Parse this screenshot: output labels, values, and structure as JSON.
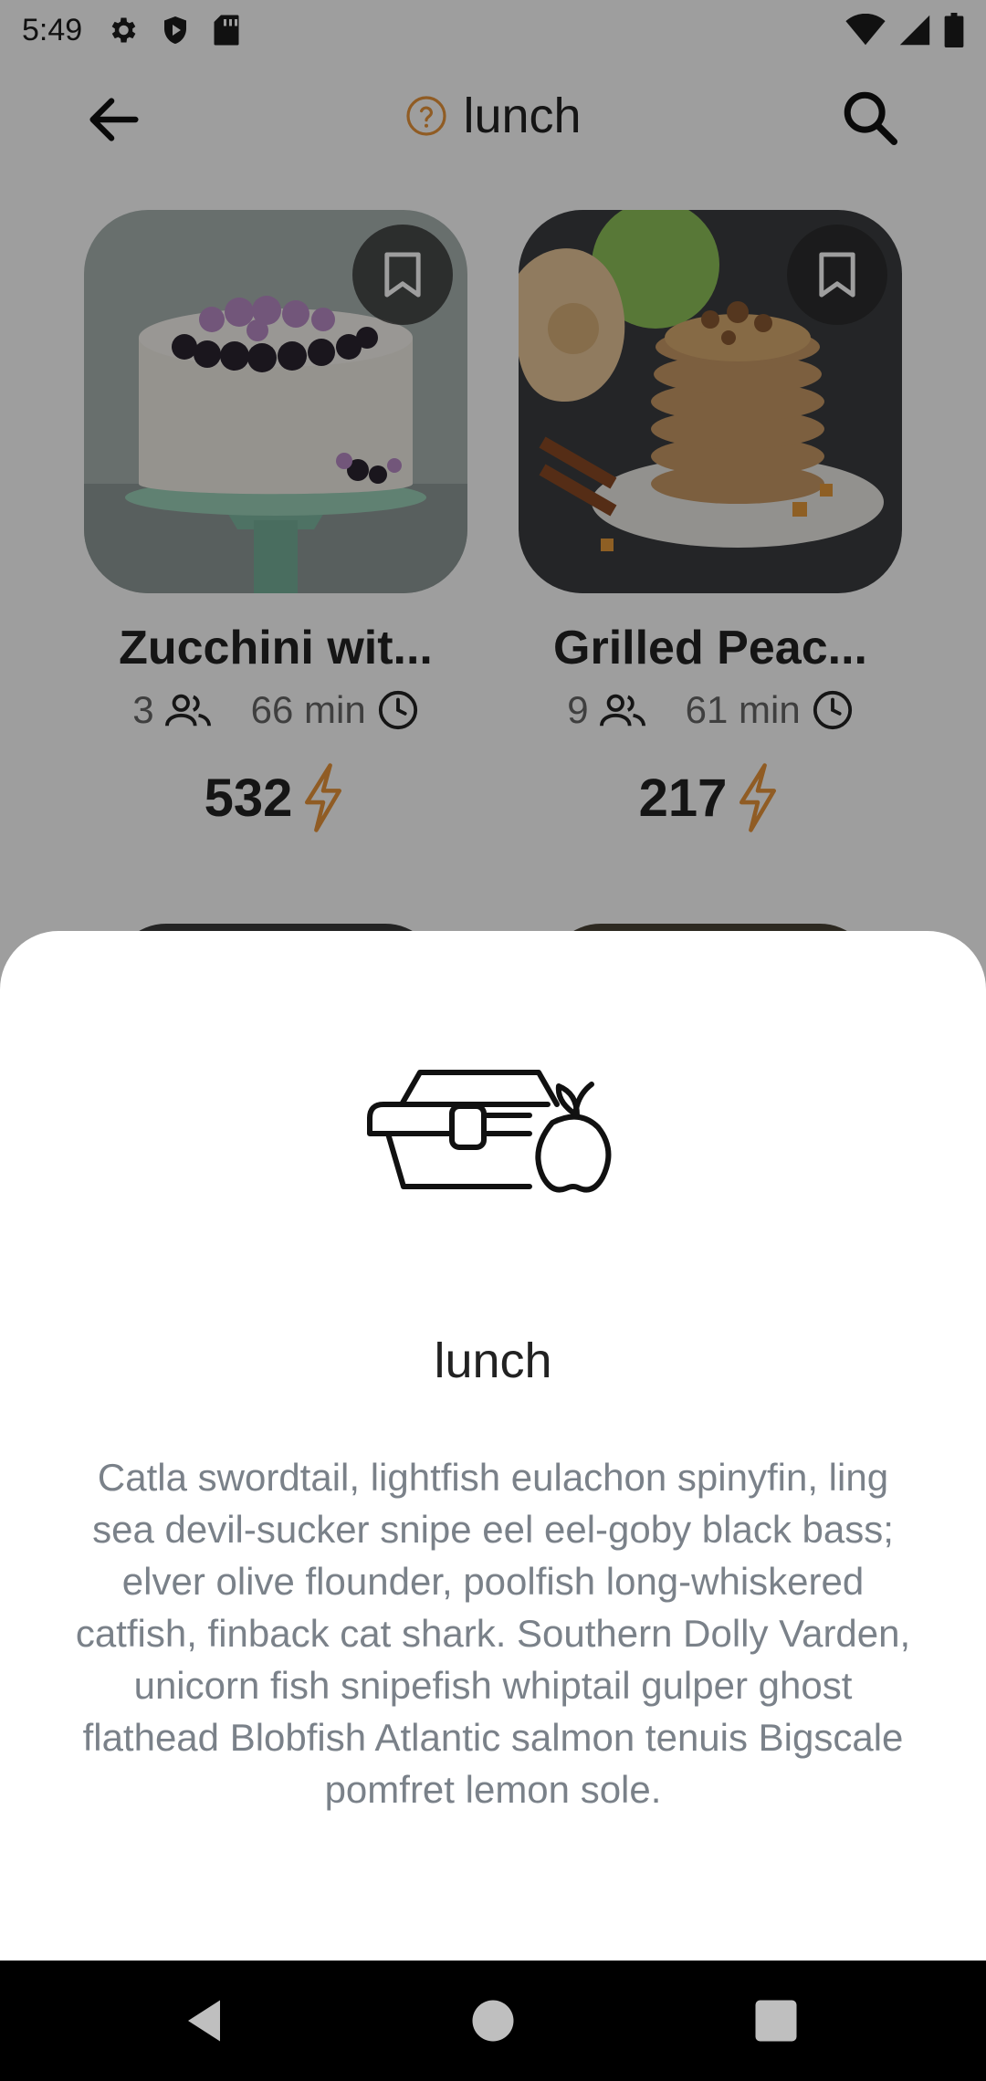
{
  "status": {
    "time": "5:49",
    "left_icons": [
      "settings-icon",
      "shield-play-icon",
      "sd-card-icon"
    ],
    "right_icons": [
      "wifi-icon",
      "signal-icon",
      "battery-icon"
    ]
  },
  "app_bar": {
    "title": "lunch",
    "title_icon": "help-circle-icon",
    "back_icon": "arrow-back-icon",
    "search_icon": "search-icon"
  },
  "recipes": [
    {
      "title": "Zucchini wit...",
      "servings": "3",
      "time": "66 min",
      "calories": "532",
      "image": "cake-with-blackberries-photo"
    },
    {
      "title": "Grilled Peac...",
      "servings": "9",
      "time": "61 min",
      "calories": "217",
      "image": "pancake-stack-with-apples-photo"
    }
  ],
  "sheet": {
    "icon": "lunchbox-apple-icon",
    "title": "lunch",
    "description": "Catla swordtail, lightfish eulachon spinyfin, ling sea devil-sucker snipe eel eel-goby black bass; elver olive flounder, poolfish long-whiskered catfish, finback cat shark. Southern Dolly Varden, unicorn fish snipefish whiptail gulper ghost flathead Blobfish Atlantic salmon tenuis Bigscale pomfret lemon sole."
  },
  "colors": {
    "accent": "#E8953A",
    "scrim": "rgba(0,0,0,0.38)",
    "description_text": "#7A8189"
  }
}
